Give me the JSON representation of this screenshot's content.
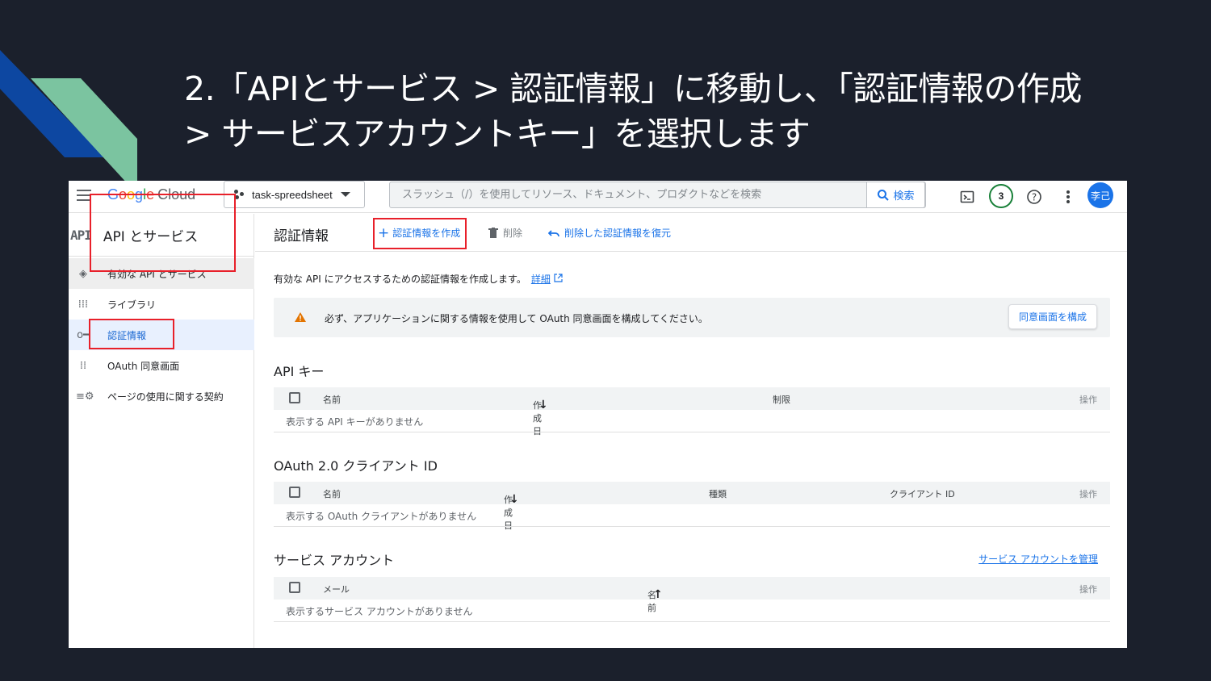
{
  "slide": {
    "title_line1": "2.「APIとサービス > 認証情報」に移動し、「認証情報の作成",
    "title_line2": "> サービスアカウントキー」を選択します"
  },
  "colors": {
    "accent_blue": "#0d47a1",
    "accent_green": "#7bc4a0",
    "background": "#1b202c",
    "highlight": "#e8202a"
  },
  "topbar": {
    "logo_letters": [
      "G",
      "o",
      "o",
      "g",
      "l",
      "e"
    ],
    "logo_cloud": "Cloud",
    "project": "task-spreedsheet",
    "search_placeholder": "スラッシュ（/）を使用してリソース、ドキュメント、プロダクトなどを検索",
    "search_button": "検索",
    "notification_count": "3",
    "avatar": "李己",
    "icons": [
      "menu-icon",
      "terminal-icon",
      "help-icon",
      "more-vert-icon"
    ]
  },
  "sidebar": {
    "logo": "API",
    "title": "API とサービス",
    "items": [
      {
        "icon": "◈",
        "label": "有効な API とサービス"
      },
      {
        "icon": "⁞⁞⁞",
        "label": "ライブラリ"
      },
      {
        "icon": "o━",
        "label": "認証情報"
      },
      {
        "icon": "⁞⁞",
        "label": "OAuth 同意画面"
      },
      {
        "icon": "≡⚙",
        "label": "ページの使用に関する契約"
      }
    ]
  },
  "main": {
    "title": "認証情報",
    "create_label": "認証情報を作成",
    "delete_label": "削除",
    "restore_label": "削除した認証情報を復元",
    "intro_text": "有効な API にアクセスするための認証情報を作成します。",
    "intro_link": "詳細",
    "warning_text": "必ず、アプリケーションに関する情報を使用して OAuth 同意画面を構成してください。",
    "warning_button": "同意画面を構成",
    "api_keys": {
      "title": "API キー",
      "columns": [
        "名前",
        "作成日",
        "制限",
        "操作"
      ],
      "empty": "表示する API キーがありません"
    },
    "oauth": {
      "title": "OAuth 2.0 クライアント ID",
      "columns": [
        "名前",
        "作成日",
        "種類",
        "クライアント ID",
        "操作"
      ],
      "empty": "表示する OAuth クライアントがありません"
    },
    "service_accounts": {
      "title": "サービス アカウント",
      "manage_link": "サービス アカウントを管理",
      "columns": [
        "メール",
        "名前",
        "操作"
      ],
      "empty": "表示するサービス アカウントがありません"
    }
  }
}
